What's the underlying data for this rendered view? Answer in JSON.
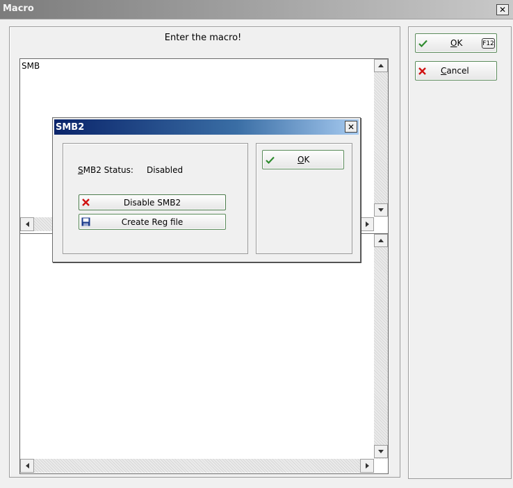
{
  "window": {
    "title": "Macro"
  },
  "prompt": "Enter the macro!",
  "editor": {
    "content": "SMB"
  },
  "buttons": {
    "ok": {
      "label": "OK",
      "underline": "O",
      "rest": "K",
      "shortcut": "F12"
    },
    "cancel": {
      "label": "Cancel",
      "underline": "C",
      "rest": "ancel"
    }
  },
  "dialog": {
    "title": "SMB2",
    "status_label_underline": "S",
    "status_label_rest": "MB2 Status:",
    "status_value": "Disabled",
    "disable_label": "Disable SMB2",
    "create_reg_label": "Create Reg file",
    "ok": {
      "underline": "O",
      "rest": "K"
    }
  },
  "colors": {
    "accent_green": "#2e8b2e",
    "cancel_red": "#d01010",
    "dialog_title": "#0a246a"
  }
}
